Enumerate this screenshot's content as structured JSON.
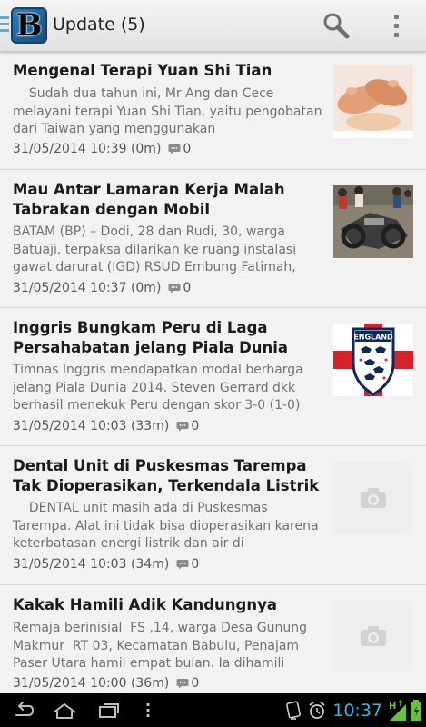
{
  "actionbar": {
    "title": "Update (5)",
    "app_logo_letter": "B"
  },
  "articles": [
    {
      "title": "Mengenal Terapi Yuan Shi Tian",
      "excerpt": "    Sudah dua tahun ini, Mr Ang dan Cece melayani terapi Yuan Shi Tian, yaitu pengobatan dari Taiwan yang menggunakan",
      "datetime": "31/05/2014 10:39 (0m)",
      "comments": "0",
      "thumbnail": "feet-massage"
    },
    {
      "title": "Mau Antar Lamaran Kerja Malah Tabrakan dengan Mobil",
      "excerpt": "BATAM (BP) – Dodi, 28 dan Rudi, 30, warga Batuaji, terpaksa dilarikan ke ruang instalasi gawat darurat (IGD) RSUD Embung Fatimah,",
      "datetime": "31/05/2014 10:37 (0m)",
      "comments": "0",
      "thumbnail": "motorcycle-crash"
    },
    {
      "title": "Inggris Bungkam Peru di Laga Persahabatan jelang Piala Dunia",
      "excerpt": "Timnas Inggris mendapatkan modal berharga jelang Piala Dunia 2014. Steven Gerrard dkk berhasil menekuk Peru dengan skor 3-0 (1-0)",
      "datetime": "31/05/2014 10:03 (33m)",
      "comments": "0",
      "thumbnail": "england-crest",
      "thumbnail_label": "ENGLAND"
    },
    {
      "title": "Dental Unit di Puskesmas Tarempa Tak Dioperasikan, Terkendala Listrik",
      "excerpt": "    DENTAL unit masih ada di Puskesmas Tarempa. Alat ini tidak bisa dioperasikan karena keterbatasan energi listrik dan air di",
      "datetime": "31/05/2014 10:03 (34m)",
      "comments": "0",
      "thumbnail": "camera-placeholder"
    },
    {
      "title": "Kakak Hamili Adik Kandungnya",
      "excerpt": "Remaja berinisial  FS ,14, warga Desa Gunung Makmur  RT 03, Kecamatan Babulu, Penajam Paser Utara hamil empat bulan. Ia dihamili",
      "datetime": "31/05/2014 10:00 (36m)",
      "comments": "0",
      "thumbnail": "camera-placeholder"
    }
  ],
  "statusbar": {
    "time": "10:37"
  },
  "colors": {
    "accent": "#33b5e5",
    "title_text": "#1a1a1a",
    "excerpt_text": "#707070",
    "england_red": "#d8222b"
  }
}
